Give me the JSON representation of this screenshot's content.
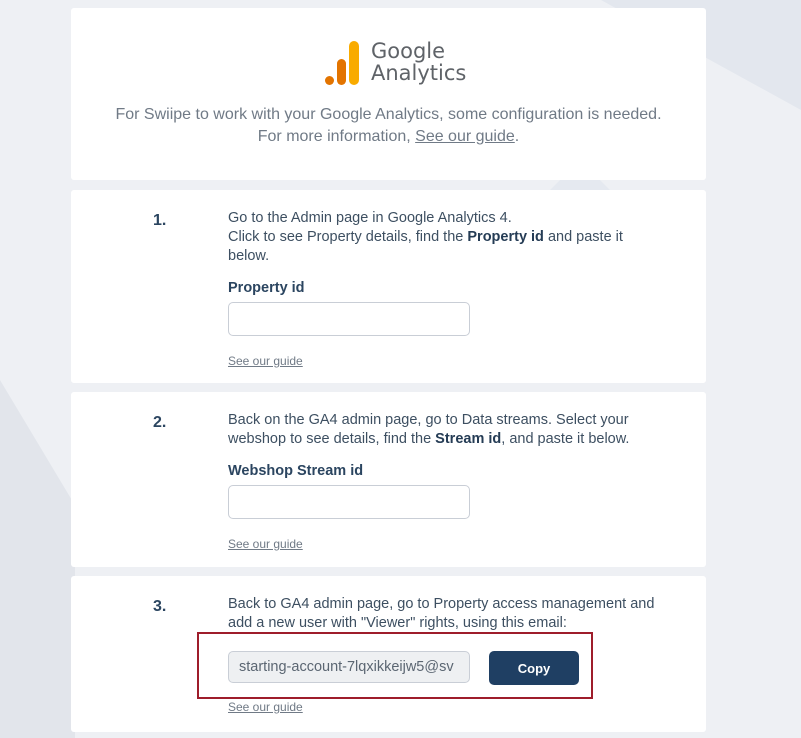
{
  "header": {
    "logo_brand": "Google",
    "logo_product": "Analytics",
    "intro_line1": "For Swiipe to work with your Google Analytics, some configuration is needed.",
    "intro_line2_prefix": "For more information, ",
    "intro_link": "See our guide",
    "intro_line2_suffix": "."
  },
  "steps": [
    {
      "number": "1.",
      "line1": "Go to the Admin page in Google Analytics 4.",
      "line2_prefix": "Click to see Property details, find the ",
      "line2_bold": "Property id",
      "line2_suffix": " and paste it below.",
      "field_label": "Property id",
      "field_value": "",
      "guide_link": "See our guide"
    },
    {
      "number": "2.",
      "line1_prefix": "Back on the GA4 admin page, go to Data streams. Select your webshop to see details, find the ",
      "line1_bold": "Stream id",
      "line1_suffix": ", and paste it below.",
      "field_label": "Webshop Stream id",
      "field_value": "",
      "guide_link": "See our guide"
    },
    {
      "number": "3.",
      "line1": "Back to GA4 admin page, go to Property access management and add a new user with \"Viewer\" rights, using this email:",
      "email_value": "starting-account-7lqxikkeijw5@sv",
      "copy_label": "Copy",
      "guide_link": "See our guide"
    }
  ],
  "colors": {
    "accent": "#1f3f63",
    "highlight": "#9e1d2b",
    "logo_orange": "#e37400",
    "logo_yellow": "#f9ab00"
  }
}
